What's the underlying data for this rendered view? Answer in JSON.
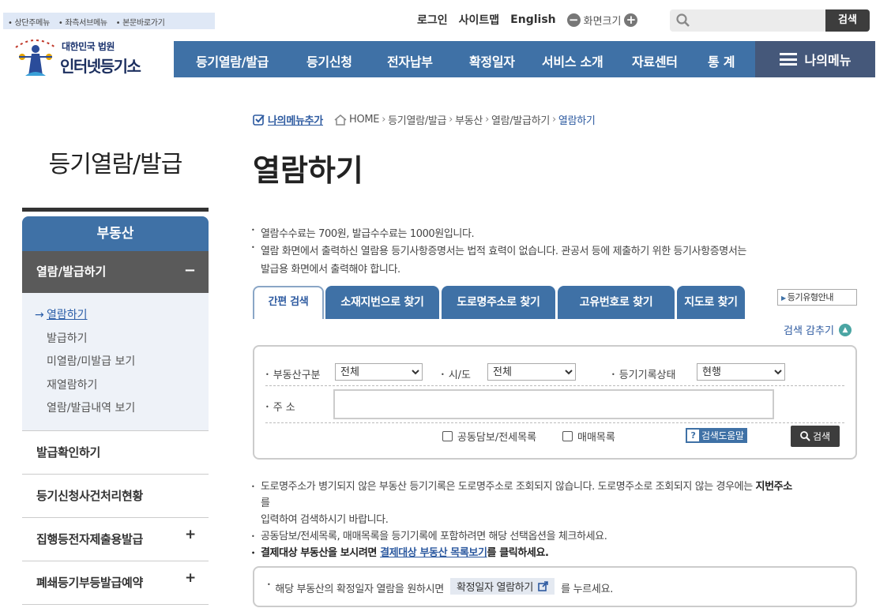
{
  "skip_links": [
    "상단주메뉴",
    "좌측서브메뉴",
    "본문바로가기"
  ],
  "logo": {
    "small": "대한민국 법원",
    "big": "인터넷등기소"
  },
  "util": {
    "login": "로그인",
    "sitemap": "사이트맵",
    "english": "English",
    "zoom_label": "화면크기"
  },
  "search": {
    "placeholder": "",
    "button": "검색"
  },
  "gnb": [
    "등기열람/발급",
    "등기신청",
    "전자납부",
    "확정일자",
    "서비스 소개",
    "자료센터",
    "통 계"
  ],
  "my_menu": "나의메뉴",
  "lnb": {
    "title": "등기열람/발급",
    "head": "부동산",
    "active": "열람/발급하기",
    "active_toggle": "−",
    "sub": [
      "열람하기",
      "발급하기",
      "미열람/미발급 보기",
      "재열람하기",
      "열람/발급내역 보기"
    ],
    "current_arrow": "→",
    "rows": [
      {
        "label": "발급확인하기",
        "toggle": ""
      },
      {
        "label": "등기신청사건처리현황",
        "toggle": ""
      },
      {
        "label": "집행등전자제출용발급",
        "toggle": "+"
      },
      {
        "label": "폐쇄등기부등발급예약",
        "toggle": "+"
      }
    ]
  },
  "breadcrumb": {
    "add_menu": "나의메뉴추가",
    "items": [
      "HOME",
      "등기열람/발급",
      "부동산",
      "열람/발급하기",
      "열람하기"
    ],
    "sep": "›"
  },
  "page_title": "열람하기",
  "notices": [
    "열람수수료는 700원, 발급수수료는 1000원입니다.",
    "열람 화면에서 출력하신 열람용 등기사항증명서는 법적 효력이 없습니다. 관공서 등에 제출하기 위한 등기사항증명서는",
    "발급용 화면에서 출력해야 합니다."
  ],
  "bullet": "•",
  "tabs": [
    "간편 검색",
    "소재지번으로 찾기",
    "도로명주소로 찾기",
    "고유번호로 찾기",
    "지도로 찾기"
  ],
  "type_guide": "등기유형안내",
  "hide_search": "검색 감추기",
  "form": {
    "type_label": "부동산구분",
    "type_value": "전체",
    "sido_label": "시/도",
    "sido_value": "전체",
    "status_label": "등기기록상태",
    "status_value": "현행",
    "address_label": "주 소",
    "address_value": "",
    "check1": "공동담보/전세목록",
    "check2": "매매목록",
    "help": "검색도움말",
    "search_button": "검색"
  },
  "foot_notes": {
    "line1_a": "도로명주소가 병기되지 않은 부동산 등기기록은 도로명주소로 조회되지 않습니다. 도로명주소로 조회되지 않는 경우에는 ",
    "line1_strong": "지번주소",
    "line1_b": "를",
    "line2": "입력하여 검색하시기 바랍니다.",
    "line3": "공동담보/전세목록, 매매목록을 등기기록에 포함하려면 해당 선택옵션을 체크하세요.",
    "line4_a": "결제대상 부동산을 보시려면 ",
    "line4_link": "결제대상 부동산 목록보기",
    "line4_b": "를 클릭하세요."
  },
  "confirm": {
    "before": "해당 부동산의 확정일자 열람을 원하시면",
    "button": "확정일자 열람하기",
    "after": "를 누르세요."
  },
  "colors": {
    "primary": "#3f71a6",
    "dark": "#45587a",
    "lnb_active": "#5a5a5a"
  }
}
